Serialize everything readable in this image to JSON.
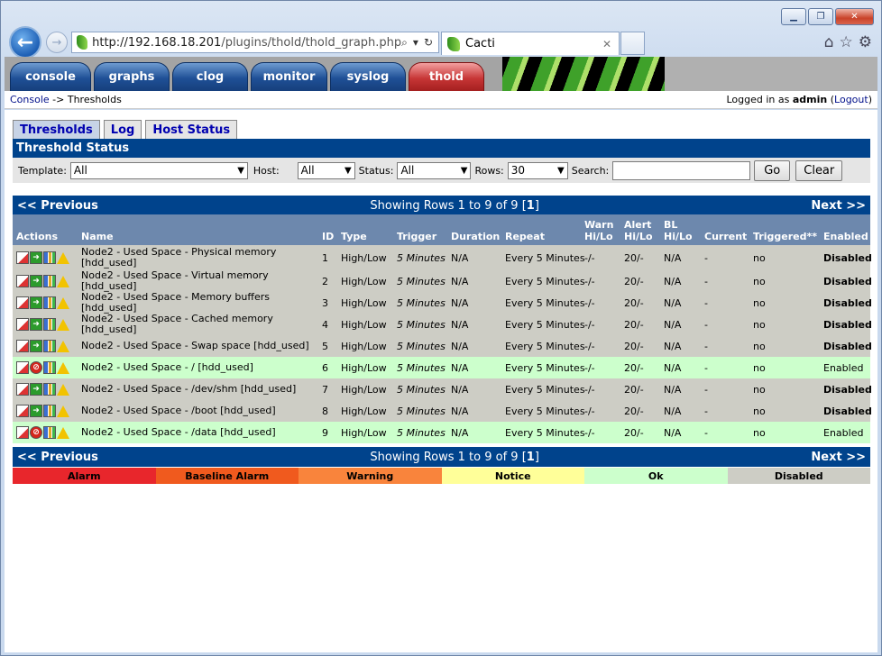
{
  "browser": {
    "url_host": "http://192.168.18.201",
    "url_path": "/plugins/thold/thold_graph.php",
    "tab_title": "Cacti"
  },
  "nav_tabs": [
    "console",
    "graphs",
    "clog",
    "monitor",
    "syslog",
    "thold"
  ],
  "breadcrumb": {
    "root": "Console",
    "sep": " -> ",
    "current": "Thresholds"
  },
  "login": {
    "prefix": "Logged in as ",
    "user": "admin",
    "logout": "Logout"
  },
  "subtabs": [
    "Thresholds",
    "Log",
    "Host Status"
  ],
  "section_title": "Threshold Status",
  "filters": {
    "template_label": "Template:",
    "template_value": "All",
    "host_label": "Host:",
    "host_value": "All",
    "status_label": "Status:",
    "status_value": "All",
    "rows_label": "Rows:",
    "rows_value": "30",
    "search_label": "Search:",
    "go": "Go",
    "clear": "Clear"
  },
  "pager": {
    "prev": "<< Previous",
    "info_prefix": "Showing Rows 1 to 9 of 9 [",
    "page": "1",
    "info_suffix": "]",
    "next": "Next >>"
  },
  "columns": {
    "actions": "Actions",
    "name": "Name",
    "id": "ID",
    "type": "Type",
    "trigger": "Trigger",
    "duration": "Duration",
    "repeat": "Repeat",
    "warn1": "Warn",
    "warn2": "Hi/Lo",
    "alert1": "Alert",
    "alert2": "Hi/Lo",
    "bl1": "BL",
    "bl2": "Hi/Lo",
    "current": "Current",
    "triggered": "Triggered**",
    "enabled": "Enabled"
  },
  "rows": [
    {
      "name": "Node2 - Used Space - Physical memory [hdd_used]",
      "id": "1",
      "type": "High/Low",
      "trigger": "5 Minutes",
      "duration": "N/A",
      "repeat": "Every 5 Minutes",
      "warn": "-/-",
      "alert": "20/-",
      "bl": "N/A",
      "current": "-",
      "triggered": "no",
      "enabled": "Disabled"
    },
    {
      "name": "Node2 - Used Space - Virtual memory [hdd_used]",
      "id": "2",
      "type": "High/Low",
      "trigger": "5 Minutes",
      "duration": "N/A",
      "repeat": "Every 5 Minutes",
      "warn": "-/-",
      "alert": "20/-",
      "bl": "N/A",
      "current": "-",
      "triggered": "no",
      "enabled": "Disabled"
    },
    {
      "name": "Node2 - Used Space - Memory buffers [hdd_used]",
      "id": "3",
      "type": "High/Low",
      "trigger": "5 Minutes",
      "duration": "N/A",
      "repeat": "Every 5 Minutes",
      "warn": "-/-",
      "alert": "20/-",
      "bl": "N/A",
      "current": "-",
      "triggered": "no",
      "enabled": "Disabled"
    },
    {
      "name": "Node2 - Used Space - Cached memory [hdd_used]",
      "id": "4",
      "type": "High/Low",
      "trigger": "5 Minutes",
      "duration": "N/A",
      "repeat": "Every 5 Minutes",
      "warn": "-/-",
      "alert": "20/-",
      "bl": "N/A",
      "current": "-",
      "triggered": "no",
      "enabled": "Disabled"
    },
    {
      "name": "Node2 - Used Space - Swap space [hdd_used]",
      "id": "5",
      "type": "High/Low",
      "trigger": "5 Minutes",
      "duration": "N/A",
      "repeat": "Every 5 Minutes",
      "warn": "-/-",
      "alert": "20/-",
      "bl": "N/A",
      "current": "-",
      "triggered": "no",
      "enabled": "Disabled"
    },
    {
      "name": "Node2 - Used Space - / [hdd_used]",
      "id": "6",
      "type": "High/Low",
      "trigger": "5 Minutes",
      "duration": "N/A",
      "repeat": "Every 5 Minutes",
      "warn": "-/-",
      "alert": "20/-",
      "bl": "N/A",
      "current": "-",
      "triggered": "no",
      "enabled": "Enabled"
    },
    {
      "name": "Node2 - Used Space - /dev/shm [hdd_used]",
      "id": "7",
      "type": "High/Low",
      "trigger": "5 Minutes",
      "duration": "N/A",
      "repeat": "Every 5 Minutes",
      "warn": "-/-",
      "alert": "20/-",
      "bl": "N/A",
      "current": "-",
      "triggered": "no",
      "enabled": "Disabled"
    },
    {
      "name": "Node2 - Used Space - /boot [hdd_used]",
      "id": "8",
      "type": "High/Low",
      "trigger": "5 Minutes",
      "duration": "N/A",
      "repeat": "Every 5 Minutes",
      "warn": "-/-",
      "alert": "20/-",
      "bl": "N/A",
      "current": "-",
      "triggered": "no",
      "enabled": "Disabled"
    },
    {
      "name": "Node2 - Used Space - /data [hdd_used]",
      "id": "9",
      "type": "High/Low",
      "trigger": "5 Minutes",
      "duration": "N/A",
      "repeat": "Every 5 Minutes",
      "warn": "-/-",
      "alert": "20/-",
      "bl": "N/A",
      "current": "-",
      "triggered": "no",
      "enabled": "Enabled"
    }
  ],
  "legend": [
    {
      "label": "Alarm",
      "bg": "#e8262c"
    },
    {
      "label": "Baseline Alarm",
      "bg": "#f05a1e"
    },
    {
      "label": "Warning",
      "bg": "#f9843c"
    },
    {
      "label": "Notice",
      "bg": "#ffff99"
    },
    {
      "label": "Ok",
      "bg": "#ccffcc"
    },
    {
      "label": "Disabled",
      "bg": "#cdcdc5"
    }
  ],
  "colors": {
    "header_blue": "#00438c",
    "column_header": "#6d88ad",
    "disabled_row": "#cdcdc5",
    "ok_row": "#ccffcc"
  }
}
